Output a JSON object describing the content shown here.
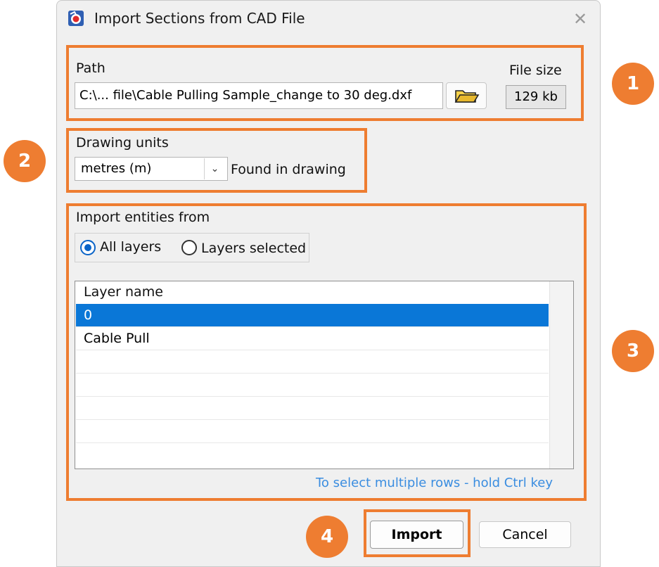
{
  "window": {
    "title": "Import Sections from CAD File",
    "close_glyph": "✕",
    "app_icon": "cad-app-icon"
  },
  "path_section": {
    "label": "Path",
    "value": "C:\\... file\\Cable Pulling Sample_change to 30 deg.dxf",
    "browse_icon": "folder-open-icon",
    "file_size_label": "File size",
    "file_size_value": "129 kb"
  },
  "units_section": {
    "label": "Drawing units",
    "selected": "metres (m)",
    "status": "Found in drawing"
  },
  "entities_section": {
    "label": "Import entities from",
    "options": [
      {
        "label": "All layers",
        "selected": true
      },
      {
        "label": "Layers selected",
        "selected": false
      }
    ],
    "table": {
      "header": "Layer name",
      "rows": [
        {
          "name": "0",
          "selected": true
        },
        {
          "name": "Cable Pull",
          "selected": false
        }
      ]
    },
    "hint": "To select multiple rows - hold Ctrl key"
  },
  "buttons": {
    "import": "Import",
    "cancel": "Cancel"
  },
  "callouts": [
    "1",
    "2",
    "3",
    "4"
  ],
  "colors": {
    "callout": "#ee7d31",
    "selection": "#0a77d7",
    "hint": "#3a8de0"
  }
}
